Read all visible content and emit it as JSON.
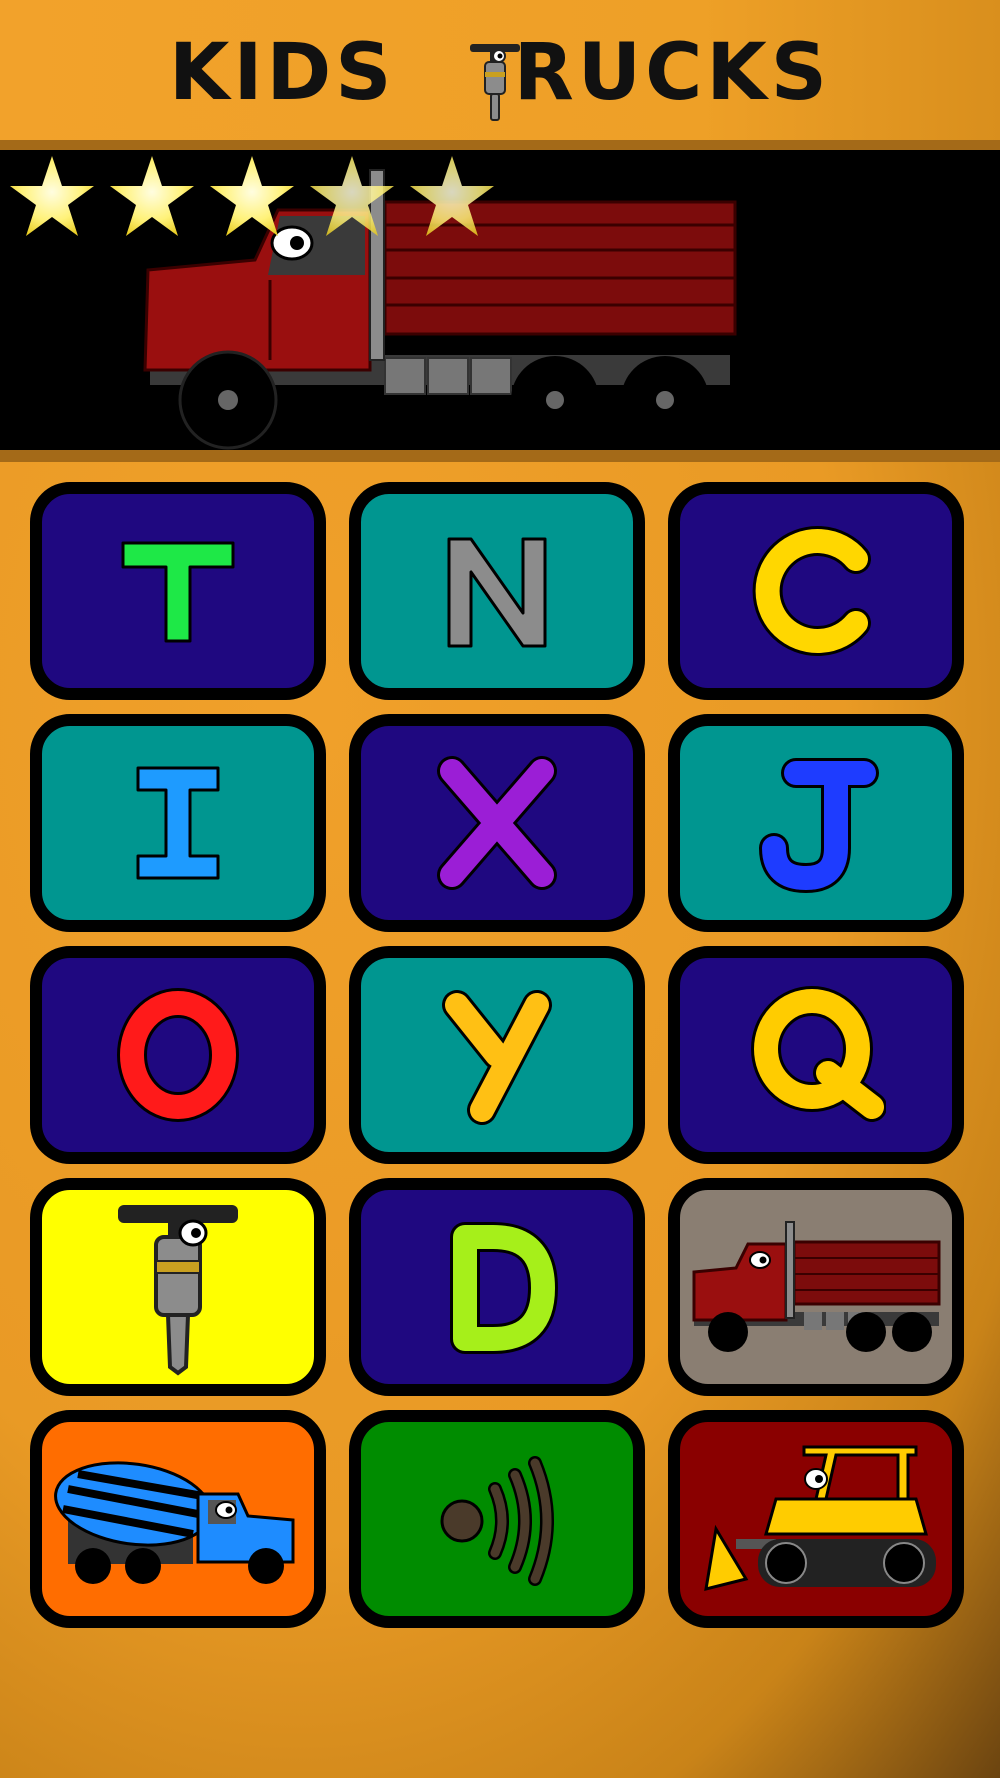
{
  "app": {
    "title_prefix": "KIDS",
    "title_suffix": "RUCKS",
    "stars_total": 5,
    "stars_filled": 5
  },
  "tiles": [
    {
      "type": "letter",
      "letter": "T",
      "bg": "#1f0880",
      "color": "#1ee847"
    },
    {
      "type": "letter",
      "letter": "N",
      "bg": "#009690",
      "color": "#8c8c8c"
    },
    {
      "type": "letter",
      "letter": "C",
      "bg": "#1f0880",
      "color": "#ffd700"
    },
    {
      "type": "letter",
      "letter": "I",
      "bg": "#009690",
      "color": "#1e9bff"
    },
    {
      "type": "letter",
      "letter": "X",
      "bg": "#1f0880",
      "color": "#9b1ed6"
    },
    {
      "type": "letter",
      "letter": "J",
      "bg": "#009690",
      "color": "#1e3cff"
    },
    {
      "type": "letter",
      "letter": "O",
      "bg": "#1f0880",
      "color": "#ff1a1a"
    },
    {
      "type": "letter",
      "letter": "Y",
      "bg": "#009690",
      "color": "#ffc014"
    },
    {
      "type": "letter",
      "letter": "Q",
      "bg": "#1f0880",
      "color": "#ffcc00"
    },
    {
      "type": "icon",
      "icon": "jackhammer-icon",
      "bg": "#ffff00"
    },
    {
      "type": "letter",
      "letter": "D",
      "bg": "#1f0880",
      "color": "#a6ef1a"
    },
    {
      "type": "icon",
      "icon": "dump-truck-icon",
      "bg": "#8a7e72"
    },
    {
      "type": "icon",
      "icon": "cement-mixer-icon",
      "bg": "#ff6d00"
    },
    {
      "type": "icon",
      "icon": "sound-icon",
      "bg": "#008c00"
    },
    {
      "type": "icon",
      "icon": "bulldozer-icon",
      "bg": "#8a0000"
    }
  ]
}
